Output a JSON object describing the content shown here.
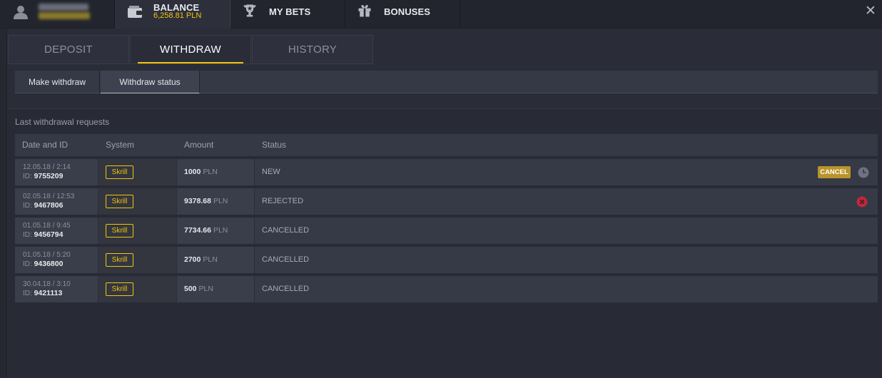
{
  "topbar": {
    "user": {
      "icon": "user-icon"
    },
    "balance": {
      "label": "BALANCE",
      "amount": "6,258.81 PLN",
      "icon": "wallet-icon"
    },
    "mybets": {
      "label": "MY BETS",
      "icon": "trophy-icon"
    },
    "bonuses": {
      "label": "BONUSES",
      "icon": "gift-icon"
    },
    "close": "✕"
  },
  "tabs": [
    {
      "label": "DEPOSIT",
      "active": false
    },
    {
      "label": "WITHDRAW",
      "active": true
    },
    {
      "label": "HISTORY",
      "active": false
    }
  ],
  "subnav": {
    "make": "Make withdraw",
    "status": "Withdraw status"
  },
  "section": {
    "title": "Last withdrawal requests",
    "columns": [
      "Date and ID",
      "System",
      "Amount",
      "Status"
    ],
    "rows": [
      {
        "date": "12.05.18 / 2:14",
        "id_prefix": "ID:",
        "id": "9755209",
        "system": "Skrill",
        "amount": "1000",
        "currency": "PLN",
        "status": "NEW",
        "action": "CANCEL",
        "icon": "clock-icon"
      },
      {
        "date": "02.05.18 / 12:53",
        "id_prefix": "ID:",
        "id": "9467806",
        "system": "Skrill",
        "amount": "9378.68",
        "currency": "PLN",
        "status": "REJECTED",
        "icon": "reject-icon"
      },
      {
        "date": "01.05.18 / 9:45",
        "id_prefix": "ID:",
        "id": "9456794",
        "system": "Skrill",
        "amount": "7734.66",
        "currency": "PLN",
        "status": "CANCELLED"
      },
      {
        "date": "01.05.18 / 5:20",
        "id_prefix": "ID:",
        "id": "9436800",
        "system": "Skrill",
        "amount": "2700",
        "currency": "PLN",
        "status": "CANCELLED"
      },
      {
        "date": "30.04.18 / 3:10",
        "id_prefix": "ID:",
        "id": "9421113",
        "system": "Skrill",
        "amount": "500",
        "currency": "PLN",
        "status": "CANCELLED"
      }
    ]
  },
  "colors": {
    "accent": "#f1c40f",
    "cancel": "#b8942a",
    "reject": "#c0283b"
  }
}
